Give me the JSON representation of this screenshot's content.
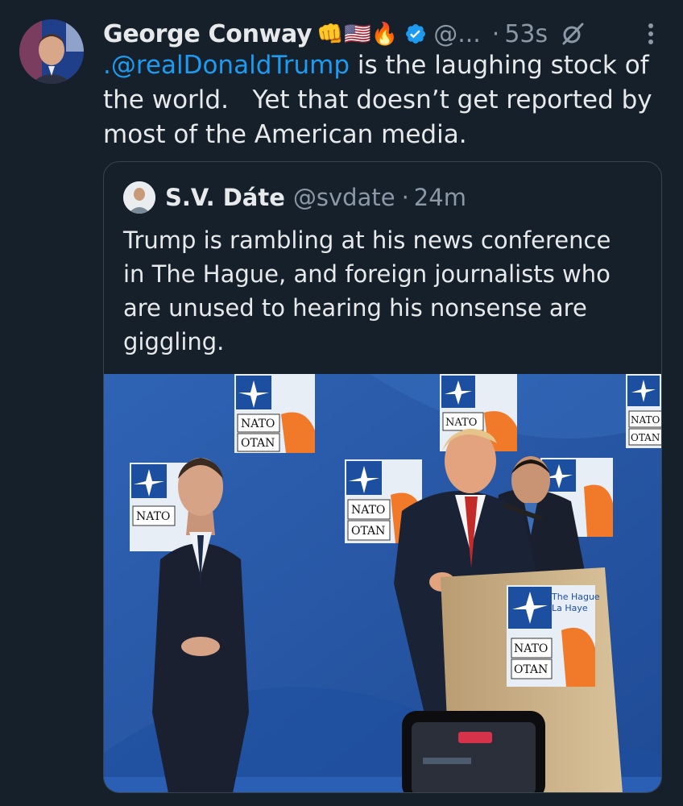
{
  "tweet": {
    "author_name": "George Conway",
    "author_emojis": "👊🇺🇸🔥",
    "author_handle": "@...",
    "separator": "·",
    "time": "53s",
    "mention": ".@realDonaldTrump",
    "text_after_mention": " is the laughing stock of the world.   Yet that doesn’t get reported by most of the American media."
  },
  "quoted": {
    "author_name": "S.V. Dáte",
    "author_handle": "@svdate",
    "separator": "·",
    "time": "24m",
    "text": "Trump is rambling at his news conference in The Hague, and foreign journalists who are unused to hearing his nonsense are giggling.",
    "photo": {
      "sign_lines": [
        "NATO",
        "OTAN"
      ],
      "location_lines": [
        "The Hague",
        "La Haye"
      ]
    }
  },
  "icons": [
    "verified-badge-icon",
    "grok-icon",
    "more-options-icon"
  ],
  "colors": {
    "background": "#15202b",
    "text": "#e7e9ea",
    "secondary": "#8b98a5",
    "link": "#1d9bf0",
    "border": "#38444d",
    "nato_blue": "#2a5ba8"
  }
}
